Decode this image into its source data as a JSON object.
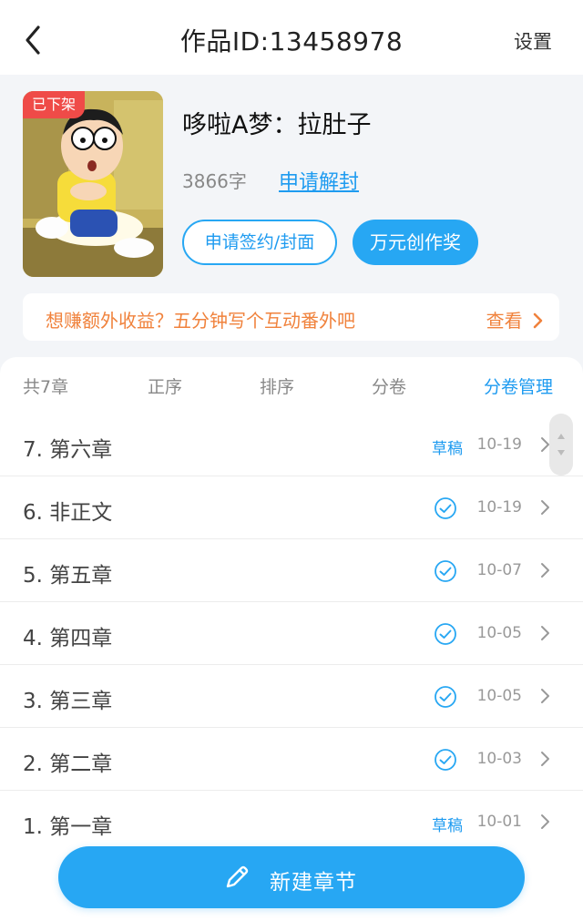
{
  "topbar": {
    "title": "作品ID:13458978",
    "settings_label": "设置"
  },
  "book": {
    "status_tag": "已下架",
    "title": "哆啦A梦：拉肚子",
    "word_count": "3866字",
    "unseal_link": "申请解封",
    "sign_button": "申请签约/封面",
    "award_button": "万元创作奖"
  },
  "promo": {
    "text": "想赚额外收益？五分钟写个互动番外吧",
    "link": "查看"
  },
  "tabs": {
    "total": "共7章",
    "order": "正序",
    "sort": "排序",
    "volume": "分卷",
    "volume_manage": "分卷管理"
  },
  "chapters": [
    {
      "title": "7. 第六章",
      "status": "草稿",
      "date": "10-19"
    },
    {
      "title": "6. 非正文",
      "status": "check-icon",
      "date": "10-19"
    },
    {
      "title": "5. 第五章",
      "status": "check-icon",
      "date": "10-07"
    },
    {
      "title": "4. 第四章",
      "status": "check-icon",
      "date": "10-05"
    },
    {
      "title": "3. 第三章",
      "status": "check-icon",
      "date": "10-05"
    },
    {
      "title": "2. 第二章",
      "status": "check-icon",
      "date": "10-03"
    },
    {
      "title": "1. 第一章",
      "status": "草稿",
      "date": "10-01"
    }
  ],
  "fab": {
    "label": "新建章节",
    "icon": "pencil-icon"
  },
  "colors": {
    "accent": "#27a7f3",
    "promo": "#f0823c",
    "tag": "#ef4b48"
  }
}
